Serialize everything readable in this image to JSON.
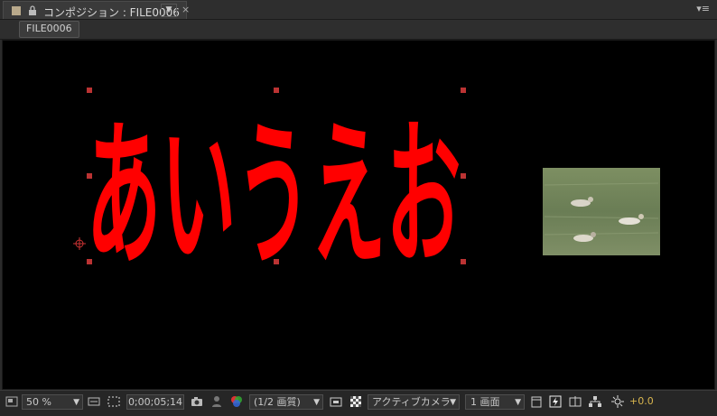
{
  "tab": {
    "title": "コンポジション : FILE0006",
    "dropdown_icon": "triangle-down-icon",
    "close_label": "×",
    "menu_icon": "panel-menu-icon"
  },
  "breadcrumb": {
    "label": "FILE0006"
  },
  "composition": {
    "text_layer": "あいうえお",
    "text_color": "#ff0000",
    "thumbnail": "ducks-on-water-image"
  },
  "toolbar": {
    "zoom": "50 %",
    "timecode": "0;00;05;14",
    "resolution": "(1/2 画質)",
    "camera": "アクティブカメラ",
    "views": "1 画面",
    "exposure": "+0.0"
  }
}
